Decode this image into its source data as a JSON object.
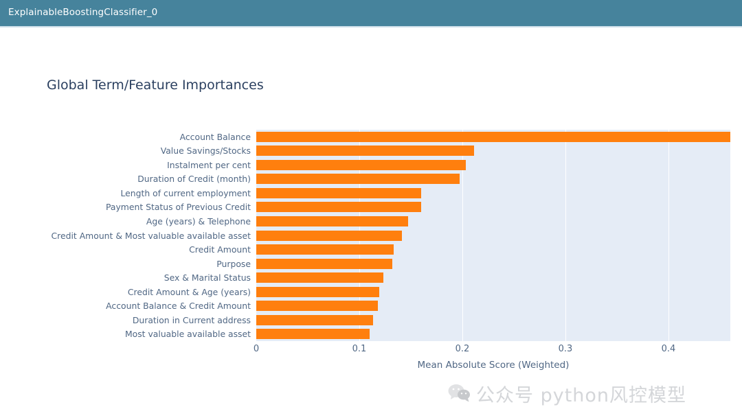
{
  "header": {
    "title": "ExplainableBoostingClassifier_0",
    "background_color": "#46839c",
    "text_color": "#ffffff"
  },
  "watermark": {
    "icon": "wechat-bubbles-icon",
    "text": "公众号 python风控模型",
    "color": "#d4d6d9"
  },
  "chart_data": {
    "type": "bar",
    "orientation": "horizontal",
    "title": "Global Term/Feature Importances",
    "xlabel": "Mean Absolute Score (Weighted)",
    "ylabel": "",
    "xlim": [
      0,
      0.46
    ],
    "xticks": [
      0,
      0.1,
      0.2,
      0.3,
      0.4
    ],
    "xticklabels": [
      "0",
      "0.1",
      "0.2",
      "0.3",
      "0.4"
    ],
    "grid": true,
    "legend": null,
    "bar_color": "#ff7f0e",
    "plot_background": "#e5ecf6",
    "categories": [
      "Account Balance",
      "Value Savings/Stocks",
      "Instalment per cent",
      "Duration of Credit (month)",
      "Length of current employment",
      "Payment Status of Previous Credit",
      "Age (years) & Telephone",
      "Credit Amount & Most valuable available asset",
      "Credit Amount",
      "Purpose",
      "Sex & Marital Status",
      "Credit Amount & Age (years)",
      "Account Balance & Credit Amount",
      "Duration in Current address",
      "Most valuable available asset"
    ],
    "values": [
      0.46,
      0.211,
      0.203,
      0.197,
      0.16,
      0.16,
      0.147,
      0.141,
      0.133,
      0.132,
      0.123,
      0.119,
      0.118,
      0.113,
      0.11
    ]
  }
}
